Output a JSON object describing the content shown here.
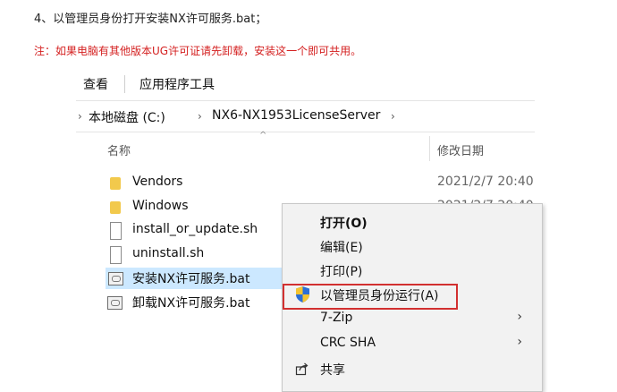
{
  "instructions": {
    "step": "4、以管理员身份打开安装NX许可服务.bat；",
    "note": "注：如果电脑有其他版本UG许可证请先卸载，安装这一个即可共用。"
  },
  "menubar": {
    "view": "查看",
    "app_tools": "应用程序工具"
  },
  "breadcrumb": {
    "parts": [
      "本地磁盘 (C:)",
      "NX6-NX1953LicenseServer"
    ]
  },
  "columns": {
    "name": "名称",
    "modified": "修改日期"
  },
  "files": [
    {
      "name": "Vendors",
      "type": "folder",
      "date": "2021/2/7 20:40"
    },
    {
      "name": "Windows",
      "type": "folder",
      "date": "2021/2/7 20:40"
    },
    {
      "name": "install_or_update.sh",
      "type": "file",
      "date": ""
    },
    {
      "name": "uninstall.sh",
      "type": "file",
      "date": ""
    },
    {
      "name": "安装NX许可服务.bat",
      "type": "bat",
      "date": "",
      "selected": true
    },
    {
      "name": "卸载NX许可服务.bat",
      "type": "bat",
      "date": ""
    }
  ],
  "context_menu": {
    "open": "打开(O)",
    "edit": "编辑(E)",
    "print": "打印(P)",
    "run_as_admin": "以管理员身份运行(A)",
    "zip": "7-Zip",
    "crc": "CRC SHA",
    "share": "共享"
  },
  "colors": {
    "note_red": "#d42020",
    "highlight_red": "#d23030",
    "selection_blue": "#cce8ff"
  }
}
